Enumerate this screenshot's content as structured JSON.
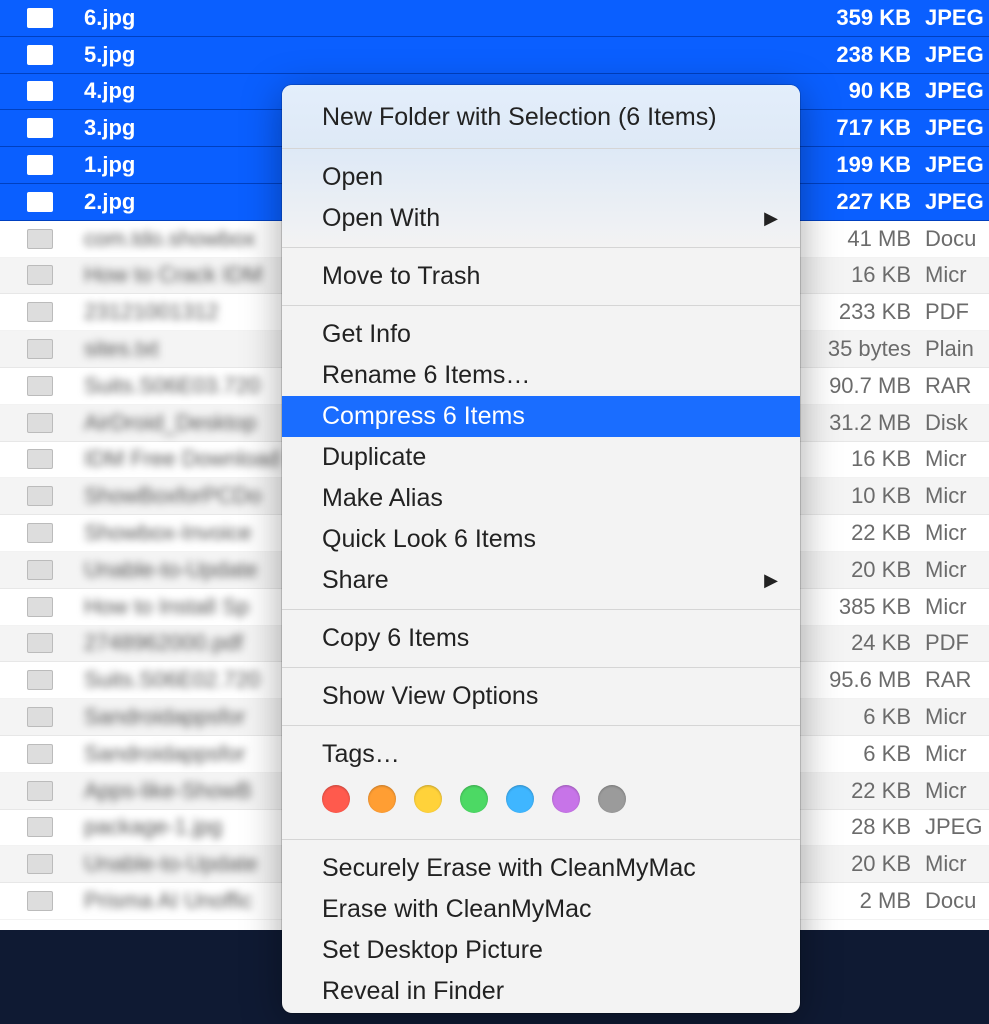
{
  "files": {
    "selected": [
      {
        "name": "6.jpg",
        "size": "359 KB",
        "kind": "JPEG"
      },
      {
        "name": "5.jpg",
        "size": "238 KB",
        "kind": "JPEG"
      },
      {
        "name": "4.jpg",
        "size": "90 KB",
        "kind": "JPEG"
      },
      {
        "name": "3.jpg",
        "size": "717 KB",
        "kind": "JPEG"
      },
      {
        "name": "1.jpg",
        "size": "199 KB",
        "kind": "JPEG"
      },
      {
        "name": "2.jpg",
        "size": "227 KB",
        "kind": "JPEG"
      }
    ],
    "unselected": [
      {
        "name": "com.tdo.showbox",
        "size": "41 MB",
        "kind": "Docu"
      },
      {
        "name": "How to Crack IDM",
        "size": "16 KB",
        "kind": "Micr"
      },
      {
        "name": "23121001312",
        "size": "233 KB",
        "kind": "PDF"
      },
      {
        "name": "sites.txt",
        "size": "35 bytes",
        "kind": "Plain"
      },
      {
        "name": "Suits.S06E03.720",
        "size": "90.7 MB",
        "kind": "RAR"
      },
      {
        "name": "AirDroid_Desktop",
        "size": "31.2 MB",
        "kind": "Disk"
      },
      {
        "name": "IDM Free Download",
        "size": "16 KB",
        "kind": "Micr"
      },
      {
        "name": "ShowBoxforPCDo",
        "size": "10 KB",
        "kind": "Micr"
      },
      {
        "name": "Showbox-Invoice",
        "size": "22 KB",
        "kind": "Micr"
      },
      {
        "name": "Unable-to-Update",
        "size": "20 KB",
        "kind": "Micr"
      },
      {
        "name": "How to Install Sp",
        "size": "385 KB",
        "kind": "Micr"
      },
      {
        "name": "2748962000.pdf",
        "size": "24 KB",
        "kind": "PDF"
      },
      {
        "name": "Suits.S06E02.720",
        "size": "95.6 MB",
        "kind": "RAR"
      },
      {
        "name": "Sandroidappsfor",
        "size": "6 KB",
        "kind": "Micr"
      },
      {
        "name": "Sandroidappsfor",
        "size": "6 KB",
        "kind": "Micr"
      },
      {
        "name": "Apps-like-ShowB",
        "size": "22 KB",
        "kind": "Micr"
      },
      {
        "name": "package-1.jpg",
        "size": "28 KB",
        "kind": "JPEG"
      },
      {
        "name": "Unable-to-Update",
        "size": "20 KB",
        "kind": "Micr"
      },
      {
        "name": "Prisma AI Unoffic",
        "size": "2 MB",
        "kind": "Docu"
      }
    ]
  },
  "menu": {
    "header": "New Folder with Selection (6 Items)",
    "open": "Open",
    "open_with": "Open With",
    "move_to_trash": "Move to Trash",
    "get_info": "Get Info",
    "rename": "Rename 6 Items…",
    "compress": "Compress 6 Items",
    "duplicate": "Duplicate",
    "make_alias": "Make Alias",
    "quick_look": "Quick Look 6 Items",
    "share": "Share",
    "copy": "Copy 6 Items",
    "show_view_options": "Show View Options",
    "tags_label": "Tags…",
    "securely_erase": "Securely Erase with CleanMyMac",
    "erase": "Erase with CleanMyMac",
    "set_desktop": "Set Desktop Picture",
    "reveal": "Reveal in Finder"
  },
  "tag_colors": [
    "#ff5a4d",
    "#ff9e33",
    "#ffd23a",
    "#4cd964",
    "#3fb6ff",
    "#c774e8",
    "#9b9b9b"
  ]
}
